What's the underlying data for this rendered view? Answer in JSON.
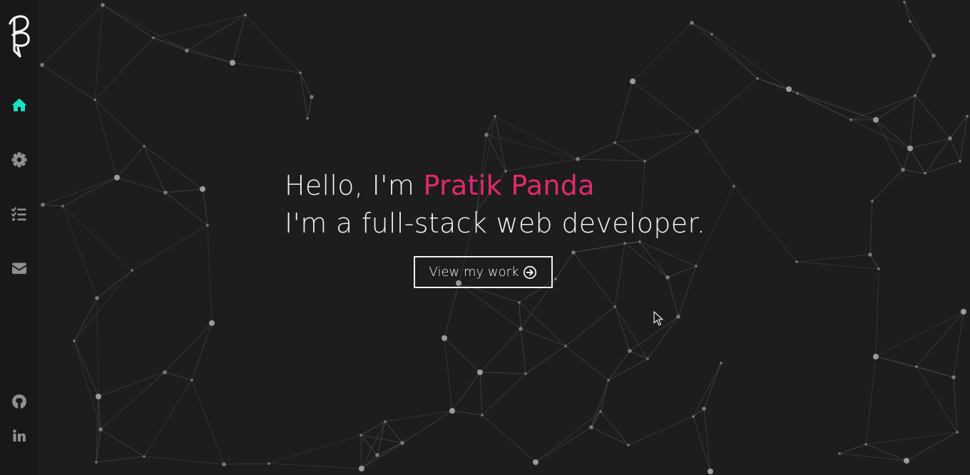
{
  "hero": {
    "greeting": "Hello, I'm ",
    "name": "Pratik Panda",
    "tagline": "I'm a full-stack web developer.",
    "cta_label": "View my work"
  },
  "nav": {
    "items": [
      {
        "name": "home",
        "icon": "home-icon",
        "active": true
      },
      {
        "name": "skills",
        "icon": "gear-icon",
        "active": false
      },
      {
        "name": "projects",
        "icon": "list-check-icon",
        "active": false
      },
      {
        "name": "contact",
        "icon": "envelope-icon",
        "active": false
      }
    ],
    "social": [
      {
        "name": "github",
        "icon": "github-icon"
      },
      {
        "name": "linkedin",
        "icon": "linkedin-icon"
      }
    ]
  },
  "colors": {
    "background": "#1d1d1d",
    "sidebar": "#181818",
    "accent_name": "#e0296e",
    "accent_active_icon": "#17e3c0",
    "icon_inactive": "#8f8f8f",
    "text": "#f2f2f2"
  }
}
